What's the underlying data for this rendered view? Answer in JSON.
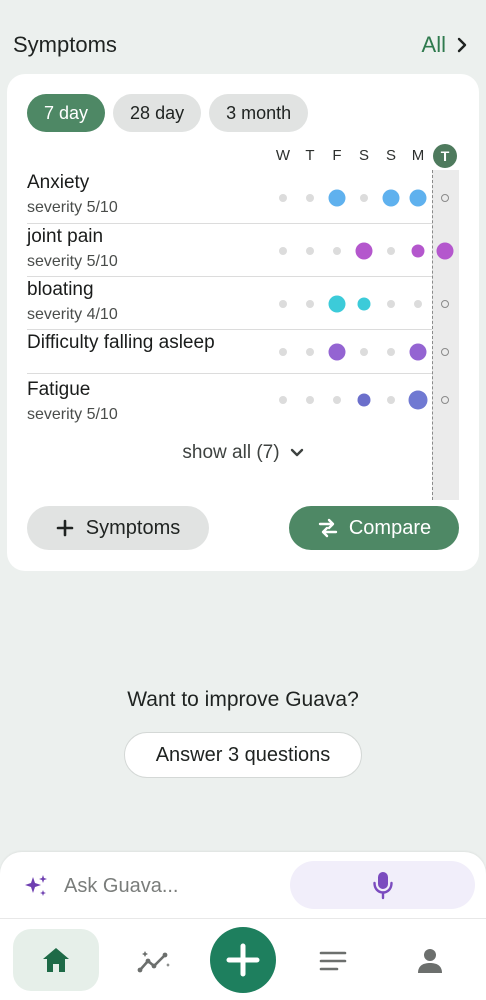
{
  "header": {
    "title": "Symptoms",
    "all_label": "All"
  },
  "ranges": [
    {
      "label": "7 day",
      "active": true
    },
    {
      "label": "28 day",
      "active": false
    },
    {
      "label": "3 month",
      "active": false
    }
  ],
  "days": [
    "W",
    "T",
    "F",
    "S",
    "S",
    "M",
    "T"
  ],
  "symptoms": [
    {
      "name": "Anxiety",
      "severity": "severity 5/10",
      "dots": [
        {
          "size": "s",
          "color": "#dcdcdc"
        },
        {
          "size": "s",
          "color": "#dcdcdc"
        },
        {
          "size": "l",
          "color": "#5fb1ee"
        },
        {
          "size": "s",
          "color": "#dcdcdc"
        },
        {
          "size": "l",
          "color": "#5fb1ee"
        },
        {
          "size": "l",
          "color": "#5fb1ee"
        },
        {
          "size": "o",
          "color": "#8a8a8a"
        }
      ]
    },
    {
      "name": "joint pain",
      "severity": "severity 5/10",
      "dots": [
        {
          "size": "s",
          "color": "#dcdcdc"
        },
        {
          "size": "s",
          "color": "#dcdcdc"
        },
        {
          "size": "s",
          "color": "#dcdcdc"
        },
        {
          "size": "l",
          "color": "#b457cd"
        },
        {
          "size": "s",
          "color": "#dcdcdc"
        },
        {
          "size": "m",
          "color": "#b457cd"
        },
        {
          "size": "l",
          "color": "#b457cd"
        }
      ]
    },
    {
      "name": "bloating",
      "severity": "severity 4/10",
      "dots": [
        {
          "size": "s",
          "color": "#dcdcdc"
        },
        {
          "size": "s",
          "color": "#dcdcdc"
        },
        {
          "size": "l",
          "color": "#3ccbd9"
        },
        {
          "size": "m",
          "color": "#3ccbd9"
        },
        {
          "size": "s",
          "color": "#dcdcdc"
        },
        {
          "size": "s",
          "color": "#dcdcdc"
        },
        {
          "size": "o",
          "color": "#8a8a8a"
        }
      ]
    },
    {
      "name": "Difficulty falling asleep",
      "severity": "",
      "dots": [
        {
          "size": "s",
          "color": "#dcdcdc"
        },
        {
          "size": "s",
          "color": "#dcdcdc"
        },
        {
          "size": "l",
          "color": "#9464d2"
        },
        {
          "size": "s",
          "color": "#dcdcdc"
        },
        {
          "size": "s",
          "color": "#dcdcdc"
        },
        {
          "size": "l",
          "color": "#9464d2"
        },
        {
          "size": "o",
          "color": "#8a8a8a"
        }
      ]
    },
    {
      "name": "Fatigue",
      "severity": "severity 5/10",
      "dots": [
        {
          "size": "s",
          "color": "#dcdcdc"
        },
        {
          "size": "s",
          "color": "#dcdcdc"
        },
        {
          "size": "s",
          "color": "#dcdcdc"
        },
        {
          "size": "m",
          "color": "#6b6fcb"
        },
        {
          "size": "s",
          "color": "#dcdcdc"
        },
        {
          "size": "xl",
          "color": "#7079d2"
        },
        {
          "size": "o",
          "color": "#8a8a8a"
        }
      ]
    }
  ],
  "show_all_label": "show all (7)",
  "add_symptoms_label": "Symptoms",
  "compare_label": "Compare",
  "improve_text": "Want to improve Guava?",
  "answer_label": "Answer 3 questions",
  "ask": {
    "placeholder": "Ask Guava..."
  },
  "colors": {
    "accent": "#4e8865",
    "link": "#2f7a4e",
    "add_button": "#1e7f5e",
    "mic": "#7b4bbf"
  }
}
